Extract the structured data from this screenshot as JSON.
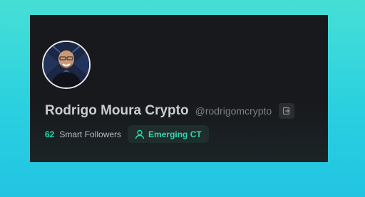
{
  "profile": {
    "display_name": "Rodrigo Moura Crypto",
    "handle": "@rodrigomcrypto",
    "avatar_icon": "user-photo"
  },
  "stats": {
    "smart_followers_count": "62",
    "smart_followers_label": "Smart Followers"
  },
  "badge": {
    "label": "Emerging CT",
    "icon": "user-icon"
  },
  "actions": {
    "link_icon": "external-link-icon"
  },
  "colors": {
    "background_gradient_top": "#46dfd6",
    "background_gradient_bottom": "#22c4e2",
    "card": "#17191d",
    "accent": "#2fd9b0",
    "name_text": "#c9ccd0",
    "handle_text": "#7d8186"
  }
}
